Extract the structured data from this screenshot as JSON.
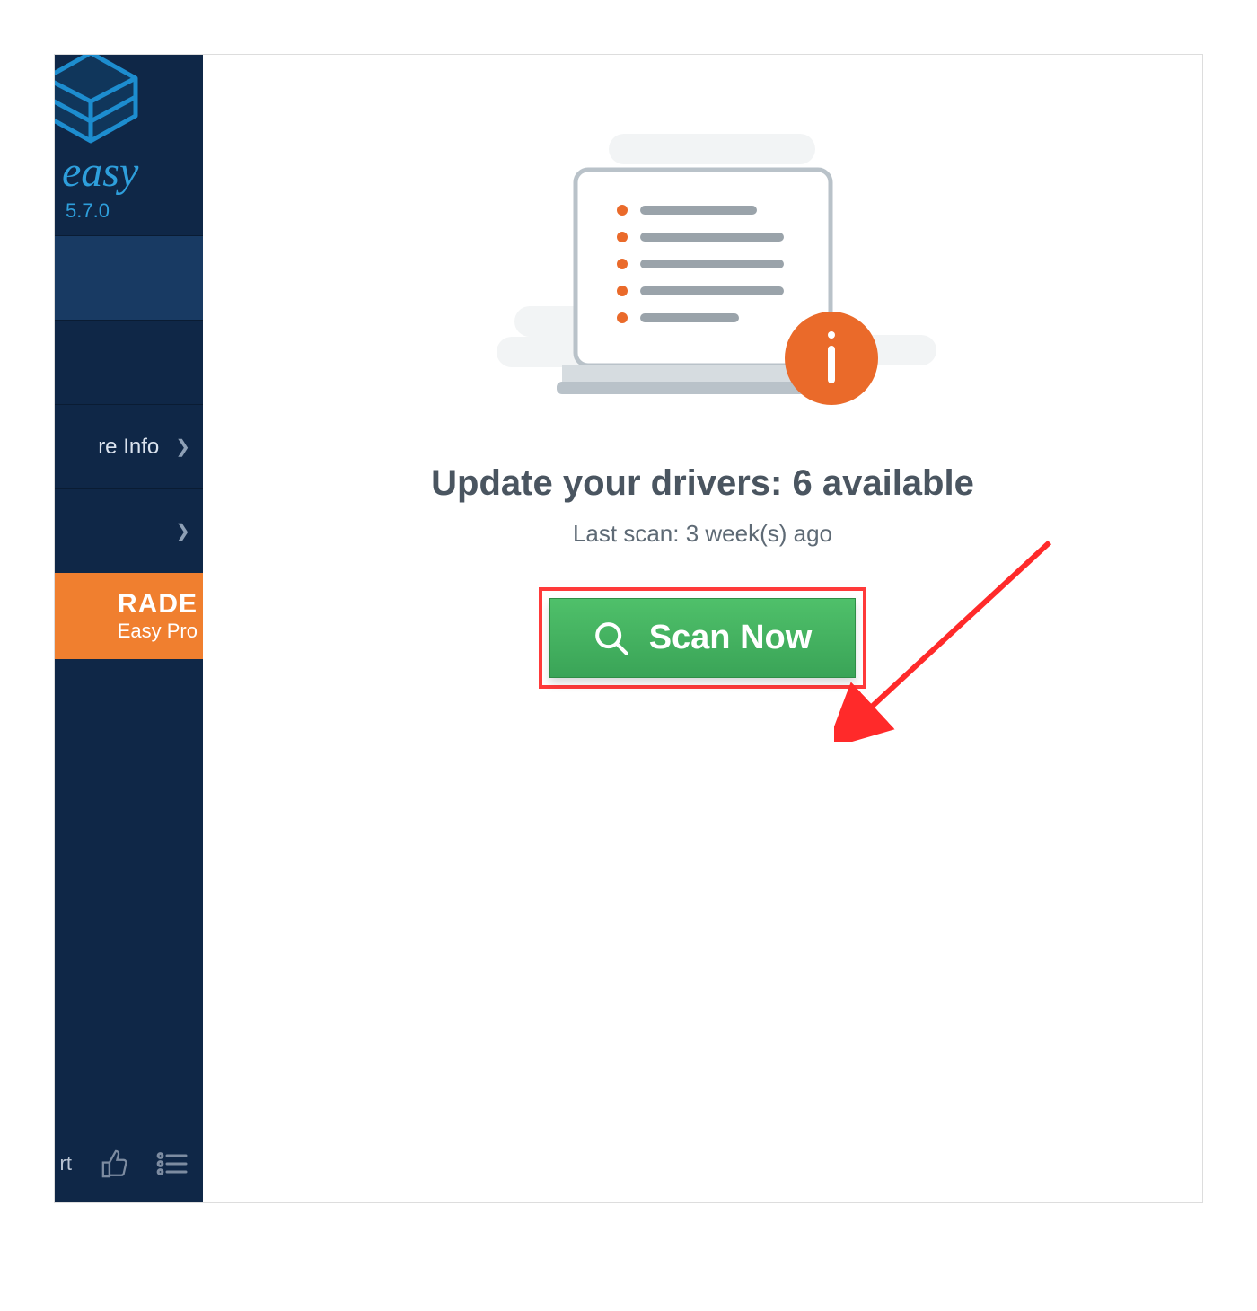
{
  "brand": {
    "name": "easy",
    "version": "5.7.0"
  },
  "sidebar": {
    "hardware_info_label": "re Info",
    "upgrade_title": "RADE",
    "upgrade_sub": "Easy Pro",
    "footer_label": "rt"
  },
  "main": {
    "heading": "Update your drivers: 6 available",
    "subheading": "Last scan: 3 week(s) ago",
    "scan_button": "Scan Now"
  }
}
